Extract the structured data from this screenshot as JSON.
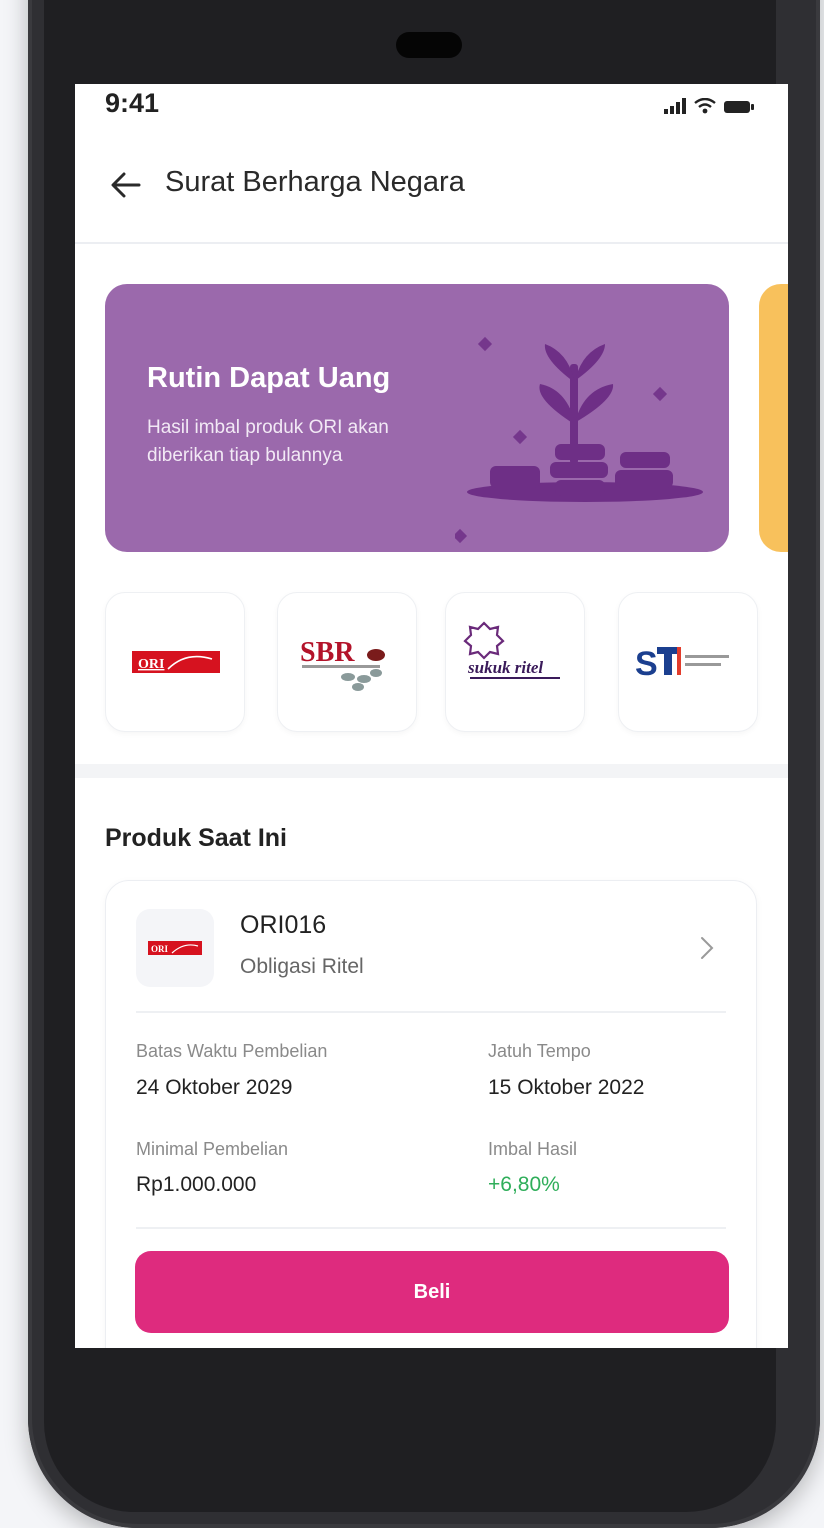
{
  "status_bar": {
    "time": "9:41"
  },
  "header": {
    "title": "Surat Berharga Negara"
  },
  "banner": {
    "title": "Rutin Dapat Uang",
    "subtitle": "Hasil imbal produk ORI akan diberikan tiap bulannya",
    "color": "#9b69ac",
    "next_banner_color": "#f8c15c"
  },
  "products": [
    {
      "name": "ORI",
      "icon": "ori-logo-icon"
    },
    {
      "name": "SBR",
      "icon": "sbr-logo-icon"
    },
    {
      "name": "sukuk ritel",
      "icon": "sukuk-ritel-logo-icon"
    },
    {
      "name": "ST",
      "icon": "st-logo-icon"
    }
  ],
  "section": {
    "title": "Produk Saat Ini"
  },
  "card": {
    "name": "ORI016",
    "type": "Obligasi Ritel",
    "fields": [
      {
        "label": "Batas Waktu Pembelian",
        "value": "24 Oktober 2029"
      },
      {
        "label": "Jatuh Tempo",
        "value": "15 Oktober 2022"
      },
      {
        "label": "Minimal Pembelian",
        "value": "Rp1.000.000"
      },
      {
        "label": "Imbal Hasil",
        "value": "+6,80%"
      }
    ],
    "buy_label": "Beli",
    "accent": "#de2b7e",
    "positive_color": "#2fae5a"
  }
}
